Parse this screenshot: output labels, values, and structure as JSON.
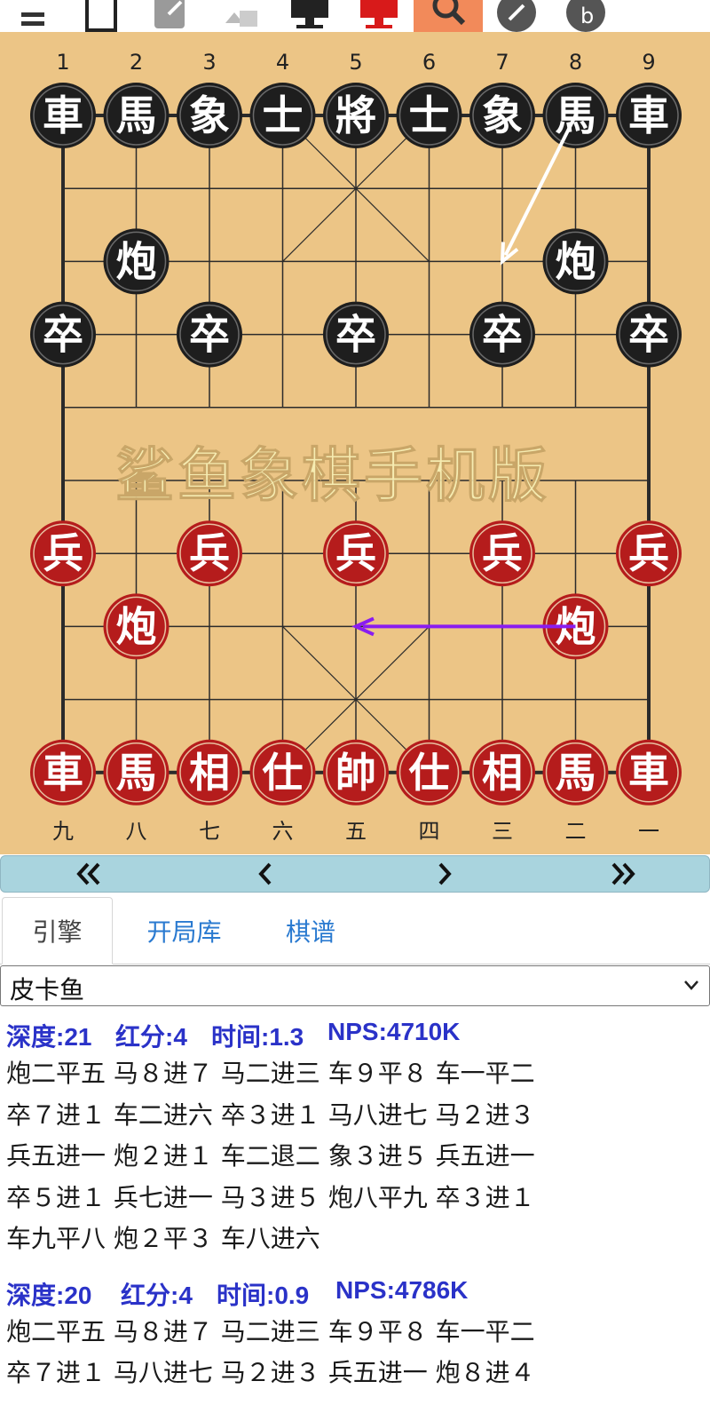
{
  "toolbar": {
    "buttons": [
      {
        "name": "menu-icon"
      },
      {
        "name": "new-board-icon"
      },
      {
        "name": "edit-icon"
      },
      {
        "name": "flip-board-icon"
      },
      {
        "name": "monitor-black-icon"
      },
      {
        "name": "monitor-red-icon"
      },
      {
        "name": "search-icon",
        "active": true
      },
      {
        "name": "pen-icon"
      },
      {
        "name": "undo-icon"
      }
    ],
    "active_color": "#f28a5a"
  },
  "board": {
    "top_labels": [
      "1",
      "2",
      "3",
      "4",
      "5",
      "6",
      "7",
      "8",
      "9"
    ],
    "bottom_labels": [
      "九",
      "八",
      "七",
      "六",
      "五",
      "四",
      "三",
      "二",
      "一"
    ],
    "watermark": "鲨鱼象棋手机版",
    "colors": {
      "board": "#ecc586",
      "line": "#2b2b2b",
      "black_piece": "#1e1e1e",
      "red_piece": "#b51c1c",
      "red_ring": "#e8c0a0",
      "black_ring": "#6a6a6a"
    },
    "pieces": [
      {
        "side": "black",
        "ch": "車",
        "col": 0,
        "row": 0
      },
      {
        "side": "black",
        "ch": "馬",
        "col": 1,
        "row": 0
      },
      {
        "side": "black",
        "ch": "象",
        "col": 2,
        "row": 0
      },
      {
        "side": "black",
        "ch": "士",
        "col": 3,
        "row": 0
      },
      {
        "side": "black",
        "ch": "將",
        "col": 4,
        "row": 0
      },
      {
        "side": "black",
        "ch": "士",
        "col": 5,
        "row": 0
      },
      {
        "side": "black",
        "ch": "象",
        "col": 6,
        "row": 0
      },
      {
        "side": "black",
        "ch": "馬",
        "col": 7,
        "row": 0
      },
      {
        "side": "black",
        "ch": "車",
        "col": 8,
        "row": 0
      },
      {
        "side": "black",
        "ch": "炮",
        "col": 1,
        "row": 2
      },
      {
        "side": "black",
        "ch": "炮",
        "col": 7,
        "row": 2
      },
      {
        "side": "black",
        "ch": "卒",
        "col": 0,
        "row": 3
      },
      {
        "side": "black",
        "ch": "卒",
        "col": 2,
        "row": 3
      },
      {
        "side": "black",
        "ch": "卒",
        "col": 4,
        "row": 3
      },
      {
        "side": "black",
        "ch": "卒",
        "col": 6,
        "row": 3
      },
      {
        "side": "black",
        "ch": "卒",
        "col": 8,
        "row": 3
      },
      {
        "side": "red",
        "ch": "兵",
        "col": 0,
        "row": 6
      },
      {
        "side": "red",
        "ch": "兵",
        "col": 2,
        "row": 6
      },
      {
        "side": "red",
        "ch": "兵",
        "col": 4,
        "row": 6
      },
      {
        "side": "red",
        "ch": "兵",
        "col": 6,
        "row": 6
      },
      {
        "side": "red",
        "ch": "兵",
        "col": 8,
        "row": 6
      },
      {
        "side": "red",
        "ch": "炮",
        "col": 1,
        "row": 7
      },
      {
        "side": "red",
        "ch": "炮",
        "col": 7,
        "row": 7
      },
      {
        "side": "red",
        "ch": "車",
        "col": 0,
        "row": 9
      },
      {
        "side": "red",
        "ch": "馬",
        "col": 1,
        "row": 9
      },
      {
        "side": "red",
        "ch": "相",
        "col": 2,
        "row": 9
      },
      {
        "side": "red",
        "ch": "仕",
        "col": 3,
        "row": 9
      },
      {
        "side": "red",
        "ch": "帥",
        "col": 4,
        "row": 9
      },
      {
        "side": "red",
        "ch": "仕",
        "col": 5,
        "row": 9
      },
      {
        "side": "red",
        "ch": "相",
        "col": 6,
        "row": 9
      },
      {
        "side": "red",
        "ch": "馬",
        "col": 7,
        "row": 9
      },
      {
        "side": "red",
        "ch": "車",
        "col": 8,
        "row": 9
      }
    ],
    "arrows": [
      {
        "from": {
          "col": 7,
          "row": 0
        },
        "to": {
          "col": 6,
          "row": 2
        },
        "color": "#ffffff"
      },
      {
        "from": {
          "col": 7,
          "row": 7
        },
        "to": {
          "col": 4,
          "row": 7
        },
        "color": "#8a1cf0"
      }
    ]
  },
  "nav": {
    "first": "«",
    "prev": "‹",
    "next": "›",
    "last": "»"
  },
  "tabs": [
    {
      "label": "引擎",
      "active": true
    },
    {
      "label": "开局库",
      "active": false
    },
    {
      "label": "棋谱",
      "active": false
    }
  ],
  "engine": {
    "selected": "皮卡鱼"
  },
  "analysis": [
    {
      "depth": "深度:21",
      "score": "红分:4",
      "time": "时间:1.3",
      "nps": "NPS:4710K",
      "lines": [
        "炮二平五 马８进７ 马二进三 车９平８ 车一平二",
        "卒７进１ 车二进六 卒３进１ 马八进七 马２进３",
        "兵五进一 炮２进１ 车二退二 象３进５ 兵五进一",
        "卒５进１ 兵七进一 马３进５ 炮八平九 卒３进１",
        "车九平八 炮２平３ 车八进六"
      ]
    },
    {
      "depth": "深度:20",
      "score": "红分:4",
      "time": "时间:0.9",
      "nps": "NPS:4786K",
      "lines": [
        "炮二平五 马８进７ 马二进三 车９平８ 车一平二",
        "卒７进１ 马八进七 马２进３ 兵五进一 炮８进４"
      ]
    }
  ]
}
